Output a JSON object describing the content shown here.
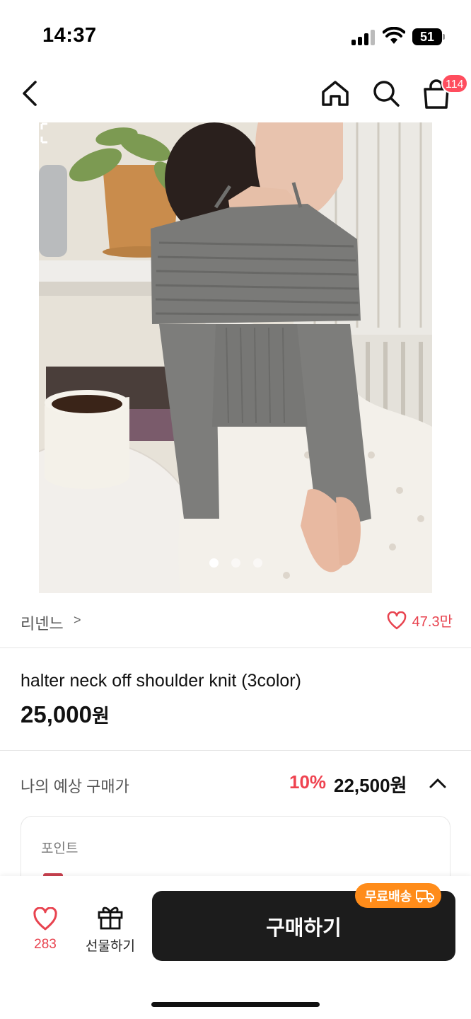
{
  "status_bar": {
    "time": "14:37",
    "battery": "51"
  },
  "nav": {
    "cart_badge": "114",
    "icons": [
      "back-icon",
      "home-icon",
      "search-icon",
      "cart-icon"
    ]
  },
  "gallery": {
    "slide_count": 3,
    "active_index": 0
  },
  "brand": {
    "name": "리넨느",
    "chevron": ">",
    "like_count": "47.3만"
  },
  "product": {
    "name": "halter neck off shoulder knit (3color)",
    "price": "25,000",
    "price_unit": "원"
  },
  "expected_price": {
    "label": "나의 예상 구매가",
    "discount": "10%",
    "price": "22,500원"
  },
  "points": {
    "title": "포인트"
  },
  "bottom_bar": {
    "wish_count": "283",
    "gift_label": "선물하기",
    "buy_label": "구매하기",
    "shipping_badge": "무료배송"
  },
  "colors": {
    "accent_red": "#ef4350",
    "shipping_orange": "#ff8c1a",
    "buy_button": "#1c1c1c"
  }
}
